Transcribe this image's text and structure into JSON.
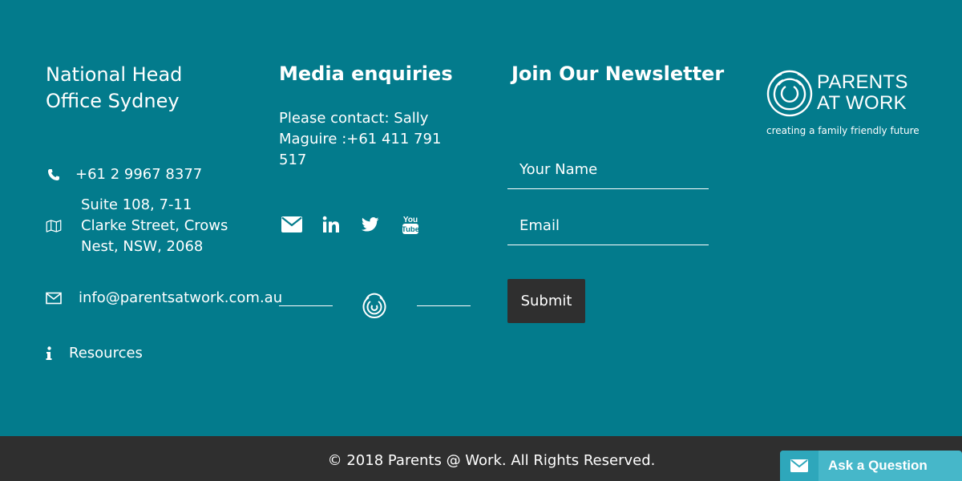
{
  "head_office": {
    "title": "National Head Office Sydney",
    "phone": "+61 2 9967 8377",
    "address": "Suite 108, 7-11 Clarke Street, Crows Nest, NSW, 2068",
    "email": "info@parentsatwork.com.au",
    "resources_label": "Resources"
  },
  "media": {
    "title": "Media enquiries",
    "text": "Please contact: Sally Maguire :+61 411 791 517",
    "social_icons": [
      "email-icon",
      "linkedin-icon",
      "twitter-icon",
      "youtube-icon"
    ]
  },
  "newsletter": {
    "title": "Join Our Newsletter",
    "name_placeholder": "Your Name",
    "email_placeholder": "Email",
    "submit_label": "Submit"
  },
  "logo": {
    "line1": "PARENTS",
    "line2": "AT WORK",
    "tagline": "creating a family friendly future"
  },
  "footer": {
    "copyright": "© 2018 Parents @ Work. All Rights Reserved."
  },
  "ask_widget": {
    "label": "Ask a Question"
  },
  "colors": {
    "background": "#037b8c",
    "bottom_bar": "#2f2f2f",
    "ask_button": "#46b7c9"
  }
}
